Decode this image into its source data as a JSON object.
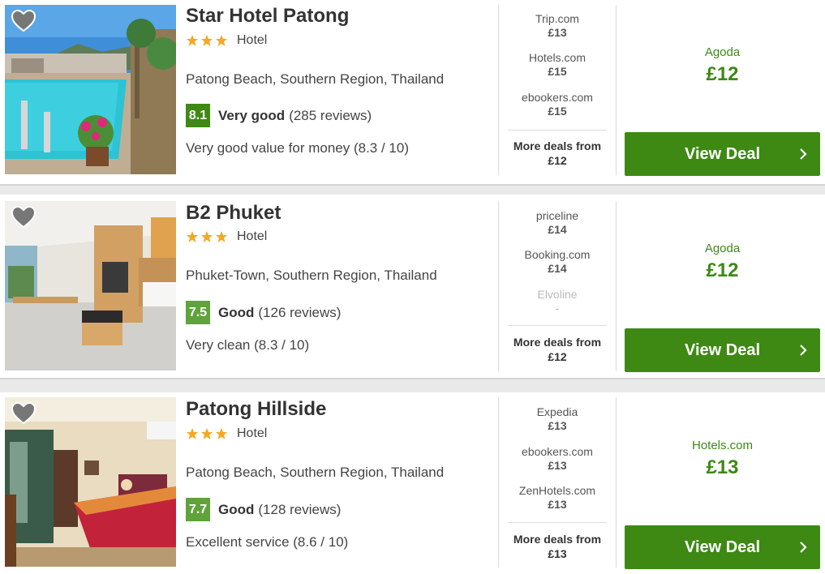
{
  "hotels": [
    {
      "name": "Star Hotel Patong",
      "type": "Hotel",
      "stars": 3,
      "location": "Patong Beach, Southern Region, Thailand",
      "score": "8.1",
      "rating_word": "Very good",
      "reviews": "(285 reviews)",
      "sub_rating": "Very good value for money (8.3 / 10)",
      "deals": [
        {
          "site": "Trip.com",
          "price": "£13"
        },
        {
          "site": "Hotels.com",
          "price": "£15"
        },
        {
          "site": "ebookers.com",
          "price": "£15"
        }
      ],
      "more_label": "More deals from",
      "more_price": "£12",
      "best_site": "Agoda",
      "best_price": "£12",
      "button": "View Deal",
      "photo_icon": "pool-photo"
    },
    {
      "name": "B2 Phuket",
      "type": "Hotel",
      "stars": 3,
      "location": "Phuket-Town, Southern Region, Thailand",
      "score": "7.5",
      "rating_word": "Good",
      "reviews": "(126 reviews)",
      "sub_rating": "Very clean (8.3 / 10)",
      "deals": [
        {
          "site": "priceline",
          "price": "£14"
        },
        {
          "site": "Booking.com",
          "price": "£14"
        },
        {
          "site": "Elvoline",
          "price": "-"
        }
      ],
      "more_label": "More deals from",
      "more_price": "£12",
      "best_site": "Agoda",
      "best_price": "£12",
      "button": "View Deal",
      "photo_icon": "room-photo"
    },
    {
      "name": "Patong Hillside",
      "type": "Hotel",
      "stars": 3,
      "location": "Patong Beach, Southern Region, Thailand",
      "score": "7.7",
      "rating_word": "Good",
      "reviews": "(128 reviews)",
      "sub_rating": "Excellent service (8.6 / 10)",
      "deals": [
        {
          "site": "Expedia",
          "price": "£13"
        },
        {
          "site": "ebookers.com",
          "price": "£13"
        },
        {
          "site": "ZenHotels.com",
          "price": "£13"
        }
      ],
      "more_label": "More deals from",
      "more_price": "£13",
      "best_site": "Hotels.com",
      "best_price": "£13",
      "button": "View Deal",
      "photo_icon": "bedroom-photo"
    }
  ],
  "colors": {
    "brand_green": "#3e8914",
    "score_light": "#5fa33a",
    "star": "#f4a823"
  }
}
